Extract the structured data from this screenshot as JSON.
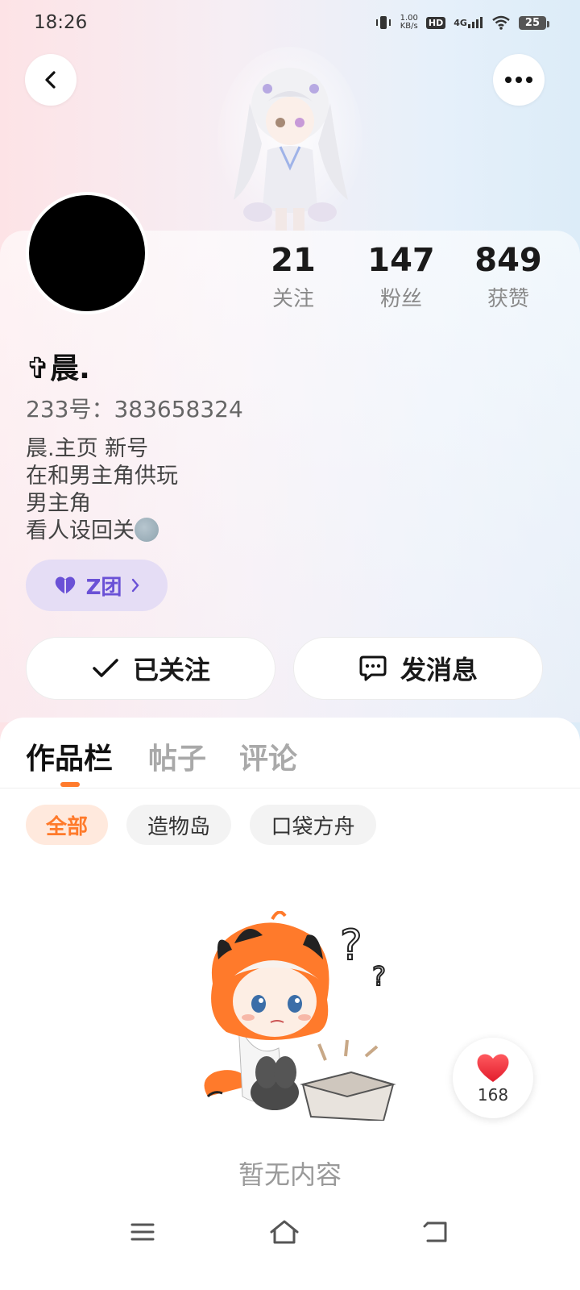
{
  "status_bar": {
    "time": "18:26",
    "net_speed_value": "1.00",
    "net_speed_unit": "KB/s",
    "hd_label": "HD",
    "network_label": "4G",
    "battery": "25",
    "icons": [
      "vibrate-icon",
      "signal-icon",
      "wifi-icon",
      "battery-icon"
    ]
  },
  "header": {
    "back_icon": "chevron-left-icon",
    "more_icon": "more-horizontal-icon"
  },
  "stats": [
    {
      "value": "21",
      "label": "关注"
    },
    {
      "value": "147",
      "label": "粉丝"
    },
    {
      "value": "849",
      "label": "获赞"
    }
  ],
  "profile": {
    "username": "✞晨.",
    "uid": "233号：383658324",
    "bio_lines": [
      "晨.主页 新号",
      "在和男主角供玩",
      "男主角",
      "看人设回关"
    ],
    "group_badge": "Z团"
  },
  "actions": {
    "follow_label": "已关注",
    "message_label": "发消息"
  },
  "tabs": [
    {
      "label": "作品栏",
      "active": true
    },
    {
      "label": "帖子",
      "active": false
    },
    {
      "label": "评论",
      "active": false
    }
  ],
  "filters": [
    {
      "label": "全部",
      "active": true
    },
    {
      "label": "造物岛",
      "active": false
    },
    {
      "label": "口袋方舟",
      "active": false
    }
  ],
  "empty_state": {
    "text": "暂无内容"
  },
  "like_float": {
    "count": "168",
    "icon": "heart-icon"
  },
  "colors": {
    "accent_orange": "#ff7a2b",
    "badge_purple": "#6a51d6",
    "heart_red": "#f2333f"
  },
  "nav_icons": [
    "menu-icon",
    "home-icon",
    "back-icon"
  ]
}
